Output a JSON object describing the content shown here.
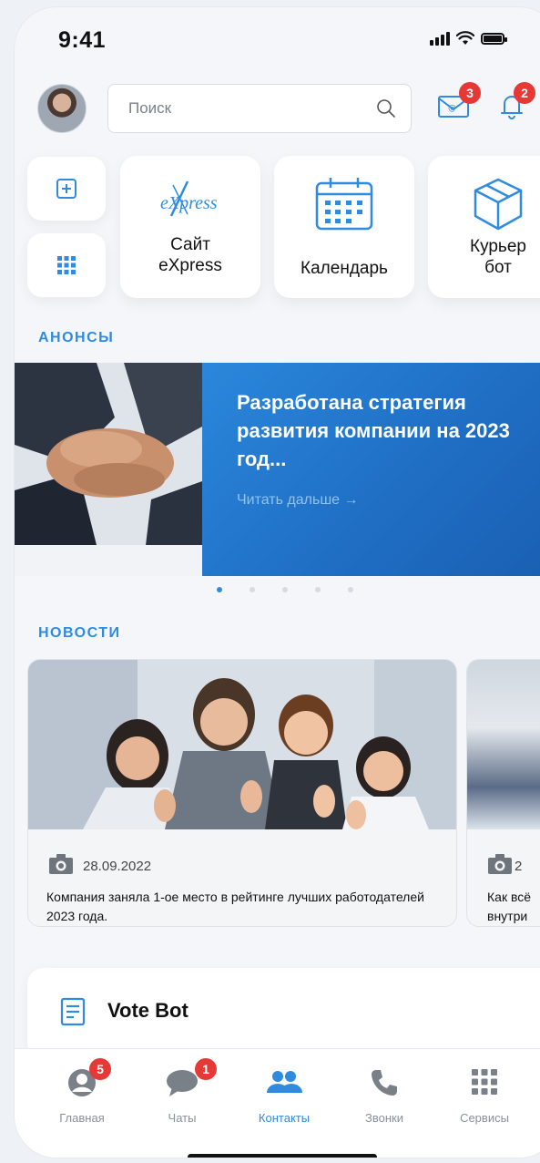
{
  "status_bar": {
    "time": "9:41"
  },
  "header": {
    "search_placeholder": "Поиск",
    "mail_badge": "3",
    "bell_badge": "2"
  },
  "quick_actions": [
    {
      "icon": "express-logo",
      "logo_text": "eXpress",
      "label_line1": "Сайт",
      "label_line2": "eXpress"
    },
    {
      "icon": "calendar-icon",
      "label_line1": "Календарь",
      "label_line2": ""
    },
    {
      "icon": "box-icon",
      "label_line1": "Курьер",
      "label_line2": "бот"
    }
  ],
  "announcements": {
    "section_title": "АНОНСЫ",
    "title": "Разработана стратегия развития компании на 2023 год...",
    "read_more": "Читать дальше  →",
    "slides": 5,
    "active_slide": 1
  },
  "news": {
    "section_title": "НОВОСТИ",
    "items": [
      {
        "date": "28.09.2022",
        "text": "Компания заняла 1-ое место в рейтинге лучших работодателей 2023 года."
      },
      {
        "date": "2",
        "text_line1": "Как всё",
        "text_line2": "внутри"
      }
    ]
  },
  "vote_bot": {
    "label": "Vote Bot"
  },
  "tabs": [
    {
      "label": "Главная",
      "badge": "5",
      "icon": "profile-icon"
    },
    {
      "label": "Чаты",
      "badge": "1",
      "icon": "chat-icon"
    },
    {
      "label": "Контакты",
      "icon": "contacts-icon",
      "active": true
    },
    {
      "label": "Звонки",
      "icon": "phone-icon"
    },
    {
      "label": "Сервисы",
      "icon": "grid-icon"
    }
  ],
  "colors": {
    "accent": "#2f8be0",
    "badge": "#e53935",
    "banner": "#1f6fc5"
  }
}
